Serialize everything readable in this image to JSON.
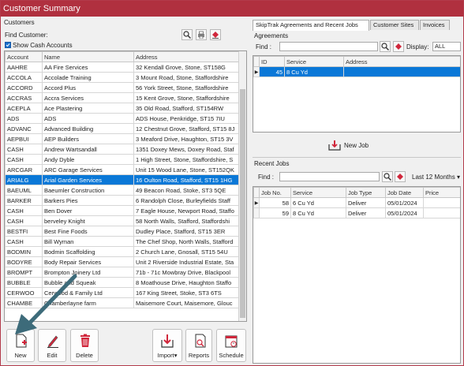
{
  "title": "Customer Summary",
  "customers": {
    "group_label": "Customers",
    "find_label": "Find Customer:",
    "show_cash_label": "Show Cash Accounts",
    "columns": [
      "Account",
      "Name",
      "Address"
    ],
    "rows": [
      [
        "AAHRE",
        "AA Fire Services",
        "32 Kendall Grove, Stone, ST158G"
      ],
      [
        "ACCOLA",
        "Accolade Training",
        "3 Mount Road, Stone, Staffordshire"
      ],
      [
        "ACCORD",
        "Accord Plus",
        "56 York Street, Stone, Staffordshire"
      ],
      [
        "ACCRAS",
        "Accra Services",
        "15 Kent Grove, Stone, Staffordshire"
      ],
      [
        "ACEPLA",
        "Ace Plastering",
        "35 Old Road, Stafford, ST154RW"
      ],
      [
        "ADS",
        "ADS",
        "ADS House, Penkridge, ST15 7IU"
      ],
      [
        "ADVANC",
        "Advanced Building",
        "12 Chestnut Grove, Stafford, ST15 8J"
      ],
      [
        "AEPBUI",
        "AEP Builders",
        "3 Meaford Drive, Haughton, ST15 3V"
      ],
      [
        "CASH",
        "Andrew Wartsandall",
        "1351 Doxey Mews, Doxey Road, Staf"
      ],
      [
        "CASH",
        "Andy Dyble",
        "1 High Street, Stone, Staffordshire, S"
      ],
      [
        "ARCGAR",
        "ARC Garage Services",
        "Unit 15 Wood Lane, Stone, ST152QK"
      ],
      [
        "ARIALG",
        "Arial Garden Services",
        "16 Oulton Road, Stafford, ST15 1HG"
      ],
      [
        "BAEUML",
        "Baeumler Construction",
        "49 Beacon Road, Stoke, ST3 5QE"
      ],
      [
        "BARKER",
        "Barkers Pies",
        "6 Randolph Close, Burleyfields Staff"
      ],
      [
        "CASH",
        "Ben Dover",
        "7 Eagle House, Newport Road, Staffo"
      ],
      [
        "CASH",
        "berveley Knight",
        "58 North Walls, Stafford, Staffordshi"
      ],
      [
        "BESTFI",
        "Best Fine Foods",
        "Dudley Place, Stafford, ST15 3ER"
      ],
      [
        "CASH",
        "Bill Wyman",
        "The Chef Shop, North Walls, Stafford"
      ],
      [
        "BODMIN",
        "Bodmin Scaffolding",
        "2 Church Lane, Gnosall, ST15 54U"
      ],
      [
        "BODYRE",
        "Body Repair Services",
        "Unit 2 Riverside Industrial Estate, Sta"
      ],
      [
        "BROMPT",
        "Brompton Joinery Ltd",
        "71b - 71c Mowbray Drive, Blackpool"
      ],
      [
        "BUBBLE",
        "Bubble and Squeak",
        "8 Moathouse Drive, Haughton Staffo"
      ],
      [
        "CERWOO",
        "Cerwood & Family Ltd",
        "167 King Street, Stoke, ST3 6TS"
      ],
      [
        "CHAMBE",
        "Chamberlayne farm",
        "Maisemore Court, Maisemore, Glouc"
      ]
    ],
    "selected_row": 11
  },
  "buttons": {
    "new": "New",
    "edit": "Edit",
    "delete": "Delete",
    "import": "Import",
    "reports": "Reports",
    "schedule": "Schedule"
  },
  "tabs": [
    "SkipTrak Agreements and Recent Jobs",
    "Customer Sites",
    "Invoices"
  ],
  "agreements": {
    "group_label": "Agreements",
    "find_label": "Find :",
    "display_label": "Display:",
    "display_value": "ALL",
    "columns": [
      "ID",
      "Service",
      "Address"
    ],
    "rows": [
      [
        "45",
        "8 Cu Yd",
        ""
      ]
    ],
    "new_job_label": "New Job"
  },
  "recent_jobs": {
    "group_label": "Recent Jobs",
    "find_label": "Find :",
    "period_value": "Last 12 Months",
    "columns": [
      "Job No.",
      "Service",
      "Job Type",
      "Job Date",
      "Price"
    ],
    "rows": [
      [
        "58",
        "6 Cu Yd",
        "Deliver",
        "05/01/2024",
        ""
      ],
      [
        "59",
        "8 Cu Yd",
        "Deliver",
        "05/01/2024",
        ""
      ]
    ]
  },
  "icons": {
    "search": "search-icon",
    "print": "print-icon",
    "clear": "eraser-icon"
  }
}
